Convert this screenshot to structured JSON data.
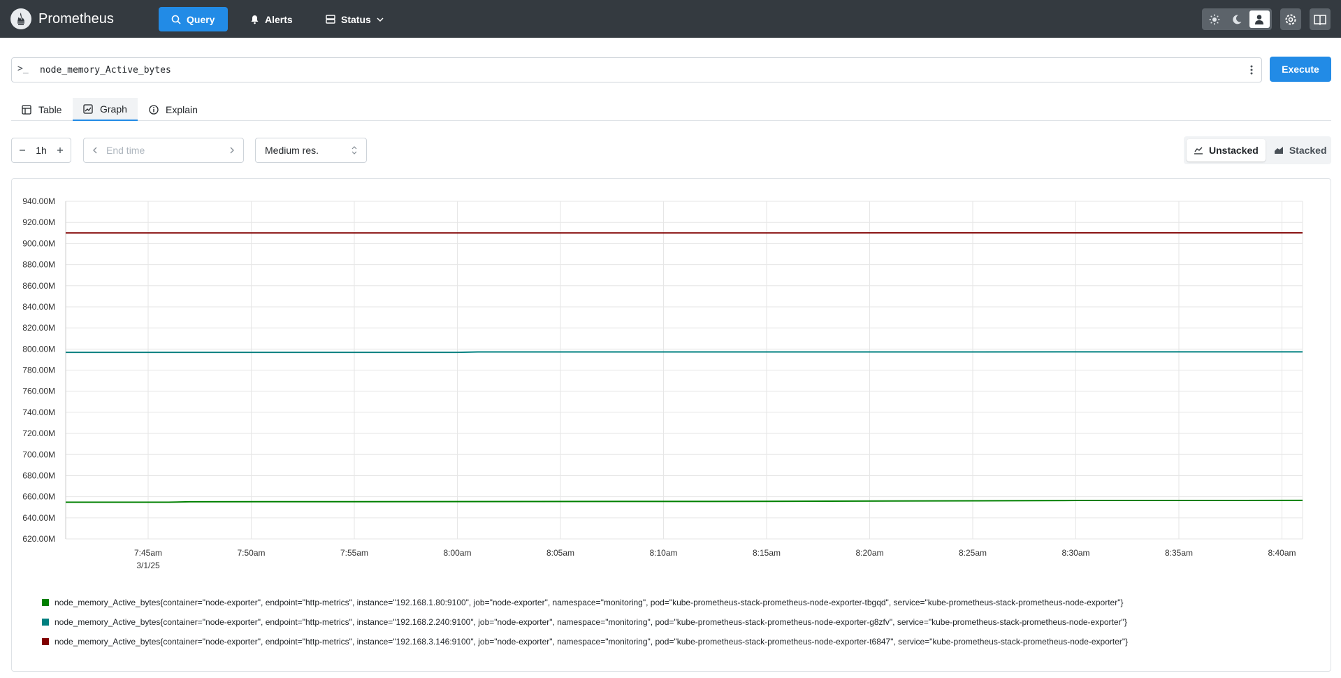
{
  "app": {
    "title": "Prometheus"
  },
  "nav": {
    "query_label": "Query",
    "alerts_label": "Alerts",
    "status_label": "Status"
  },
  "query": {
    "prompt": ">_",
    "expression": "node_memory_Active_bytes",
    "execute_label": "Execute"
  },
  "tabs": [
    {
      "label": "Table"
    },
    {
      "label": "Graph",
      "active": true
    },
    {
      "label": "Explain"
    }
  ],
  "controls": {
    "range_value": "1h",
    "end_time_placeholder": "End time",
    "resolution": "Medium res.",
    "unstacked_label": "Unstacked",
    "stacked_label": "Stacked"
  },
  "chart_data": {
    "type": "line",
    "ylim": [
      620,
      940
    ],
    "y_unit": "M",
    "y_ticks": [
      "940.00M",
      "920.00M",
      "900.00M",
      "880.00M",
      "860.00M",
      "840.00M",
      "820.00M",
      "800.00M",
      "780.00M",
      "760.00M",
      "740.00M",
      "720.00M",
      "700.00M",
      "680.00M",
      "660.00M",
      "640.00M",
      "620.00M"
    ],
    "x_ticks": [
      "7:45am",
      "7:50am",
      "7:55am",
      "8:00am",
      "8:05am",
      "8:10am",
      "8:15am",
      "8:20am",
      "8:25am",
      "8:30am",
      "8:35am",
      "8:40am"
    ],
    "x_date": "3/1/25",
    "x_minutes_start": "7:41am",
    "x_minutes_end": "8:41am",
    "series": [
      {
        "name": "node_memory_Active_bytes{container=\"node-exporter\", endpoint=\"http-metrics\", instance=\"192.168.1.80:9100\", job=\"node-exporter\", namespace=\"monitoring\", pod=\"kube-prometheus-stack-prometheus-node-exporter-tbgqd\", service=\"kube-prometheus-stack-prometheus-node-exporter\"}",
        "color": "#008000",
        "x": [
          "7:41am",
          "7:46am",
          "7:47am",
          "8:15am",
          "8:30am",
          "8:41am"
        ],
        "values": [
          654.8,
          654.8,
          655.2,
          655.6,
          656.4,
          656.5
        ]
      },
      {
        "name": "node_memory_Active_bytes{container=\"node-exporter\", endpoint=\"http-metrics\", instance=\"192.168.2.240:9100\", job=\"node-exporter\", namespace=\"monitoring\", pod=\"kube-prometheus-stack-prometheus-node-exporter-g8zfv\", service=\"kube-prometheus-stack-prometheus-node-exporter\"}",
        "color": "#008080",
        "x": [
          "7:41am",
          "8:00am",
          "8:01am",
          "8:41am"
        ],
        "values": [
          796.8,
          796.8,
          797.2,
          797.3
        ]
      },
      {
        "name": "node_memory_Active_bytes{container=\"node-exporter\", endpoint=\"http-metrics\", instance=\"192.168.3.146:9100\", job=\"node-exporter\", namespace=\"monitoring\", pod=\"kube-prometheus-stack-prometheus-node-exporter-t6847\", service=\"kube-prometheus-stack-prometheus-node-exporter\"}",
        "color": "#800000",
        "x": [
          "7:41am",
          "8:41am"
        ],
        "values": [
          910.0,
          910.1
        ]
      }
    ]
  }
}
